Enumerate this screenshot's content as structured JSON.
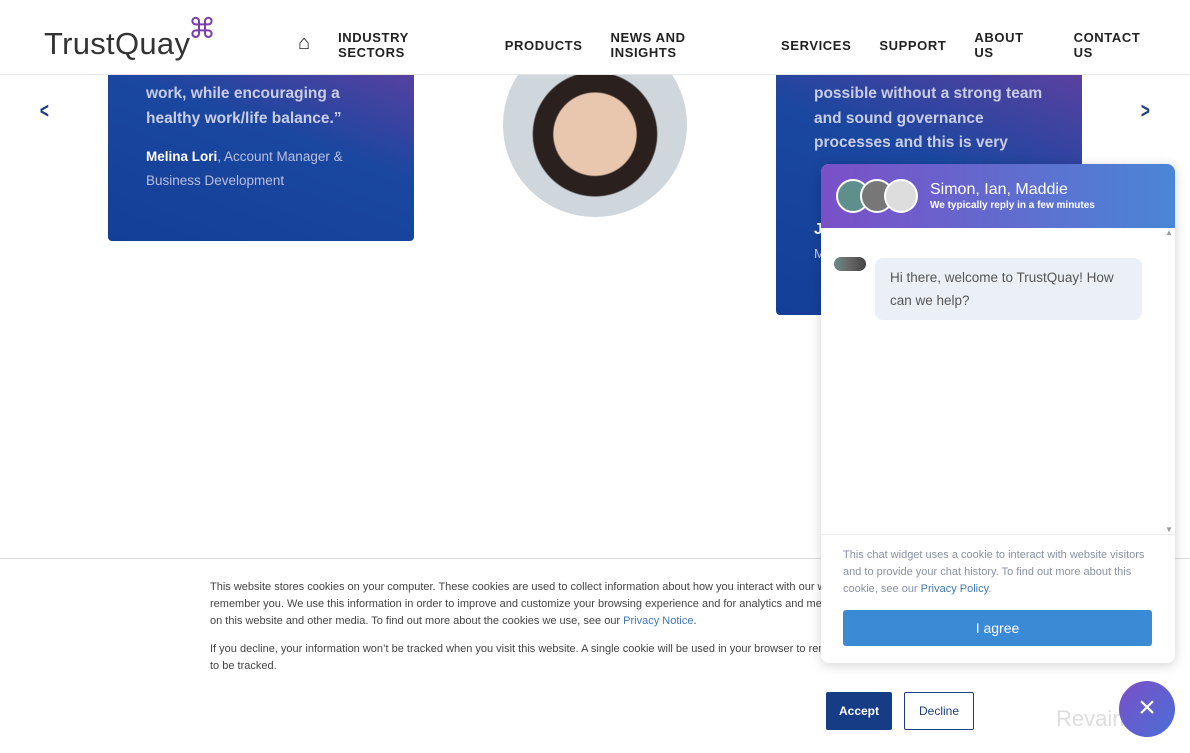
{
  "header": {
    "logo": "TrustQuay",
    "logo_mark": "⌘",
    "nav": [
      "INDUSTRY SECTORS",
      "PRODUCTS",
      "NEWS AND INSIGHTS",
      "SERVICES",
      "SUPPORT",
      "ABOUT US",
      "CONTACT US"
    ]
  },
  "testimonials": [
    {
      "quote_lines": [
        "work, while encouraging a",
        "healthy work/life balance.”"
      ],
      "author_name": "Melina Lori",
      "author_role": ", Account Manager & Business Development"
    },
    {
      "quote_lines": [
        "possible without a strong team",
        "and sound governance",
        "processes and this is very"
      ],
      "author_name": "J",
      "author_role": "M"
    }
  ],
  "chat": {
    "agents": "Simon, Ian, Maddie",
    "subtitle": "We typically reply in a few minutes",
    "message": "Hi there, welcome to TrustQuay!  How can we help?",
    "consent_text": "This chat widget uses a cookie to interact with website visitors and to provide your chat history. To find out more about this cookie, see our ",
    "consent_link": "Privacy Policy",
    "agree_label": "I agree",
    "close_icon": "×"
  },
  "cookie_banner": {
    "p1": "This website stores cookies on your computer. These cookies are used to collect information about how you interact with our website and allow us to",
    "p2": "remember you. We use this information in order to improve and customize your browsing experience and for analytics and metrics about our visitors both",
    "p3": "on this website and other media. To find out more about the cookies we use, see our ",
    "p3_link": "Privacy Notice",
    "p4": "If you decline, your information won’t be tracked when you visit this website. A single cookie will be used in your browser to remember your preference not",
    "p5": "to be tracked.",
    "accept_label": "Accept",
    "decline_label": "Decline"
  },
  "watermark": "Revain"
}
